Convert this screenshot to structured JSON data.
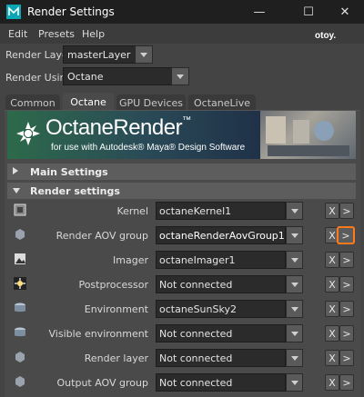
{
  "window": {
    "title": "Render Settings",
    "minimize_glyph": "—",
    "maximize_glyph": "☐",
    "close_glyph": "✕"
  },
  "menu": [
    "Edit",
    "Presets",
    "Help"
  ],
  "render_layer": {
    "label": "Render Layer",
    "value": "masterLayer"
  },
  "render_using": {
    "label": "Render Using",
    "value": "Octane"
  },
  "tabs": [
    {
      "label": "Common",
      "active": false
    },
    {
      "label": "Octane",
      "active": true
    },
    {
      "label": "GPU Devices",
      "active": false
    },
    {
      "label": "OctaneLive",
      "active": false
    }
  ],
  "banner": {
    "title": "OctaneRender",
    "tm": "™",
    "subtitle": "for use with Autodesk® Maya® Design Software",
    "brand": "otoy."
  },
  "sections": {
    "main": "Main Settings",
    "render": "Render settings"
  },
  "rows": [
    {
      "icon": "kernel-icon",
      "label": "Kernel",
      "value": "octaneKernel1",
      "x": "X",
      "go": ">",
      "highlight": false
    },
    {
      "icon": "aov-group-icon",
      "label": "Render AOV group",
      "value": "octaneRenderAovGroup1",
      "x": "X",
      "go": ">",
      "highlight": true
    },
    {
      "icon": "imager-icon",
      "label": "Imager",
      "value": "octaneImager1",
      "x": "X",
      "go": ">",
      "highlight": false
    },
    {
      "icon": "postprocessor-icon",
      "label": "Postprocessor",
      "value": "Not connected",
      "x": "X",
      "go": ">",
      "highlight": false
    },
    {
      "icon": "environment-icon",
      "label": "Environment",
      "value": "octaneSunSky2",
      "x": "X",
      "go": ">",
      "highlight": false
    },
    {
      "icon": "visible-environment-icon",
      "label": "Visible environment",
      "value": "Not connected",
      "x": "X",
      "go": ">",
      "highlight": false
    },
    {
      "icon": "render-layer-icon",
      "label": "Render layer",
      "value": "Not connected",
      "x": "X",
      "go": ">",
      "highlight": false
    },
    {
      "icon": "output-aov-group-icon",
      "label": "Output AOV group",
      "value": "Not connected",
      "x": "X",
      "go": ">",
      "highlight": false
    }
  ],
  "colors": {
    "highlight": "#ff7a1a",
    "background": "#444444"
  }
}
